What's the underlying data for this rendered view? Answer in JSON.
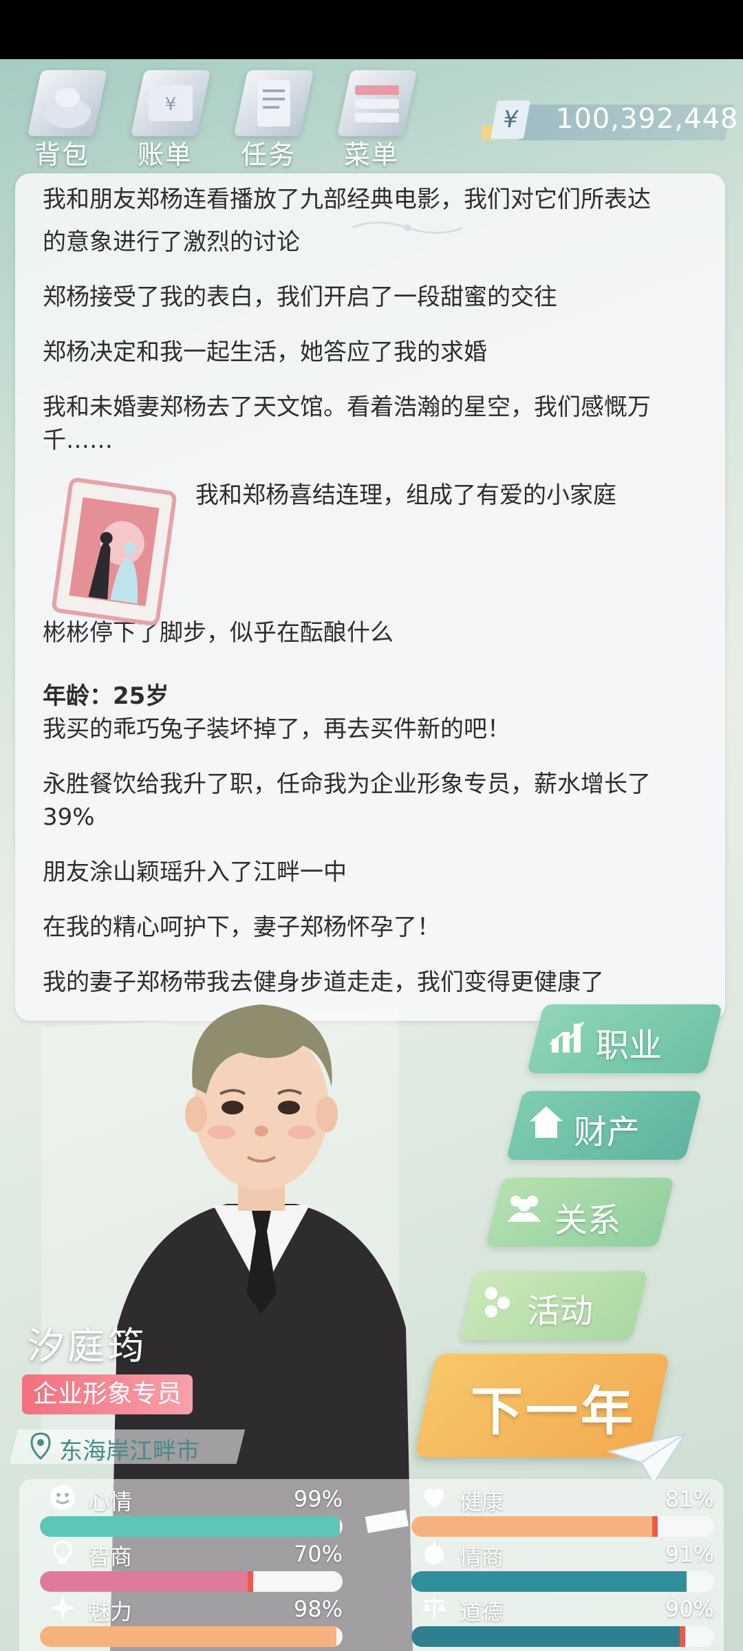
{
  "toolbar": {
    "backpack": "背包",
    "bills": "账单",
    "tasks": "任务",
    "menu": "菜单"
  },
  "money": {
    "symbol": "¥",
    "value": "100,392,448"
  },
  "log": {
    "partial_line": "我和朋友郑杨连看播放了九部经典电影，我们对它们所表达",
    "lines": [
      "的意象进行了激烈的讨论",
      "郑杨接受了我的表白，我们开启了一段甜蜜的交往",
      "郑杨决定和我一起生活，她答应了我的求婚",
      "我和未婚妻郑杨去了天文馆。看着浩瀚的星空，我们感慨万",
      "千……",
      "我和郑杨喜结连理，组成了有爱的小家庭",
      "彬彬停下了脚步，似乎在酝酿什么",
      "年龄：25岁",
      "我买的乖巧兔子装坏掉了，再去买件新的吧！",
      "永胜餐饮给我升了职，任命我为企业形象专员，薪水增长了",
      "39%",
      "朋友涂山颖瑶升入了江畔一中",
      "在我的精心呵护下，妻子郑杨怀孕了！",
      "我的妻子郑杨带我去健身步道走走，我们变得更健康了"
    ]
  },
  "character": {
    "name": "汐庭筠",
    "job": "企业形象专员",
    "location": "东海岸江畔市"
  },
  "menu_buttons": {
    "career": "职业",
    "property": "财产",
    "relations": "关系",
    "activity": "活动",
    "next_year": "下一年"
  },
  "stats": {
    "mood": {
      "label": "心情",
      "value": "99%",
      "fraction": 0.99
    },
    "health": {
      "label": "健康",
      "value": "81%",
      "fraction": 0.81
    },
    "iq": {
      "label": "智商",
      "value": "70%",
      "fraction": 0.7
    },
    "eq": {
      "label": "情商",
      "value": "91%",
      "fraction": 0.91
    },
    "charm": {
      "label": "魅力",
      "value": "98%",
      "fraction": 0.98
    },
    "morality": {
      "label": "道德",
      "value": "90%",
      "fraction": 0.9
    }
  },
  "colors": {
    "mood_bar": "#5cc6b8",
    "health_bar": "#f6b27e",
    "iq_bar": "#e07a9a",
    "eq_bar": "#2f8f9a",
    "charm_bar": "#f6b27e",
    "morality_bar": "#2f7f8f",
    "job_badge": "#f36f7f"
  }
}
